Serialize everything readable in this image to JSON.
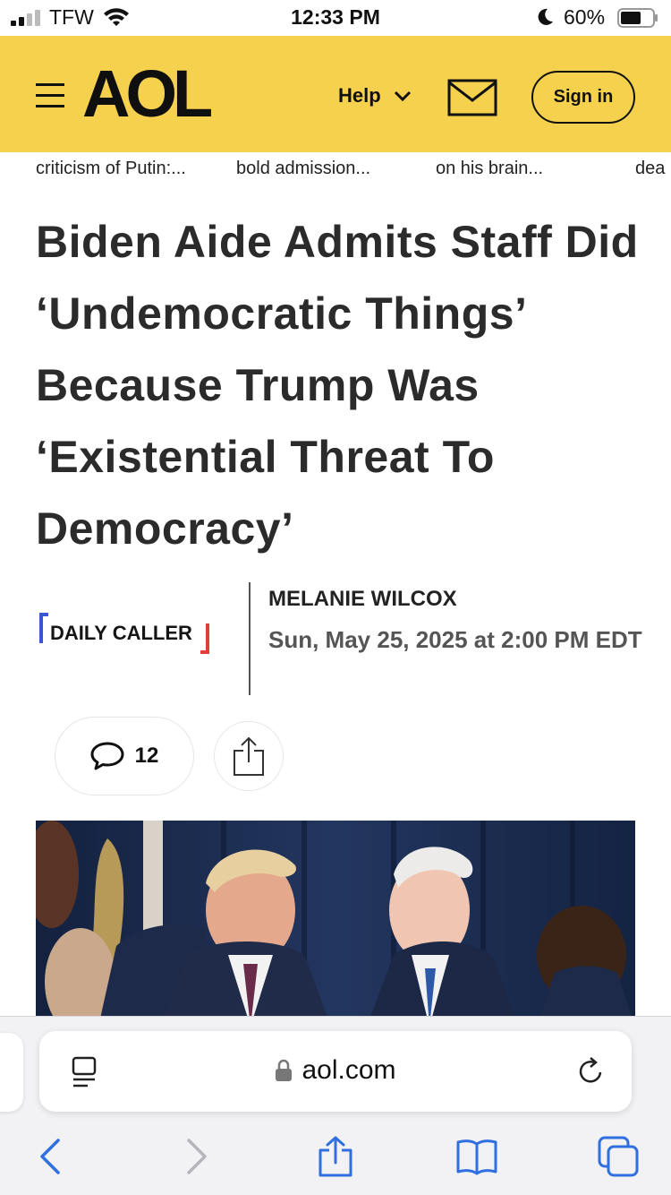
{
  "status_bar": {
    "carrier": "TFW",
    "time": "12:33 PM",
    "battery": "60%"
  },
  "header": {
    "logo": "AOL",
    "help": "Help",
    "sign_in": "Sign in"
  },
  "trending": [
    "criticism of Putin:...",
    "bold admission...",
    "on his brain...",
    "dea"
  ],
  "article": {
    "headline": "Biden Aide Admits Staff Did ‘Undemocratic Things’ Because Trump Was ‘Existential Threat To Democracy’",
    "source": "DAILY CALLER",
    "author": "MELANIE WILCOX",
    "date": "Sun, May 25, 2025 at 2:00 PM EDT",
    "comment_count": "12"
  },
  "browser": {
    "url": "aol.com"
  },
  "icons": {
    "menu": "hamburger-icon",
    "help_toggle": "chevron-down-icon",
    "mail": "mail-icon",
    "comments": "comment-bubble-icon",
    "share": "share-icon",
    "reader": "reader-mode-icon",
    "lock": "lock-icon",
    "reload": "reload-icon",
    "back": "back-arrow-icon",
    "forward": "forward-arrow-icon",
    "browser_share": "share-icon",
    "bookmarks": "bookmarks-icon",
    "tabs": "tabs-icon"
  },
  "colors": {
    "header_bg": "#f6d14e",
    "browser_accent": "#2f6fe0",
    "source_blue": "#3a56d4",
    "source_red": "#e0403a"
  }
}
